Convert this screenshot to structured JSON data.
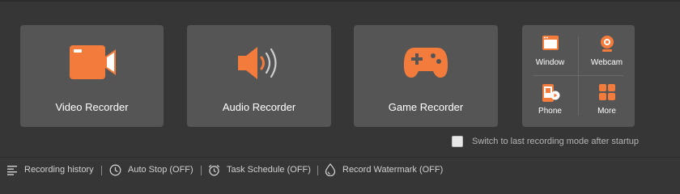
{
  "modes": {
    "video": {
      "label": "Video Recorder",
      "icon": "video-camera-icon"
    },
    "audio": {
      "label": "Audio Recorder",
      "icon": "speaker-icon"
    },
    "game": {
      "label": "Game Recorder",
      "icon": "gamepad-icon"
    }
  },
  "more_panel": {
    "window": {
      "label": "Window",
      "icon": "window-icon"
    },
    "webcam": {
      "label": "Webcam",
      "icon": "webcam-icon"
    },
    "phone": {
      "label": "Phone",
      "icon": "phone-icon"
    },
    "more": {
      "label": "More",
      "icon": "grid-icon"
    }
  },
  "switch_option": {
    "label": "Switch to last recording mode after startup",
    "checked": false
  },
  "bottom_bar": {
    "recording_history": "Recording history",
    "auto_stop": "Auto Stop (OFF)",
    "task_schedule": "Task Schedule (OFF)",
    "record_watermark": "Record Watermark (OFF)"
  },
  "colors": {
    "accent": "#f37b3c",
    "background": "#363636",
    "card": "#555555"
  }
}
